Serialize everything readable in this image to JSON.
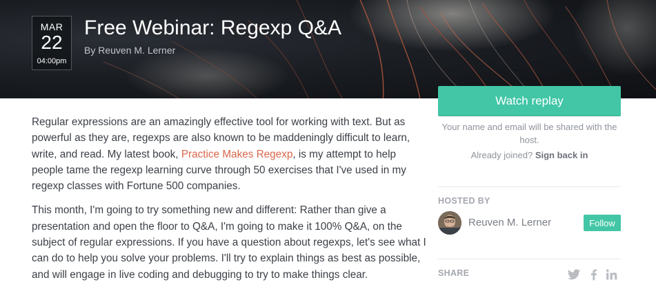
{
  "event": {
    "date": {
      "month": "MAR",
      "day": "22",
      "time": "04:00pm"
    },
    "title": "Free Webinar: Regexp Q&A",
    "byline": "By Reuven M. Lerner"
  },
  "description": {
    "p1_before_link": "Regular expressions are an amazingly effective tool for working with text. But as powerful as they are, regexps are also known to be maddeningly difficult to learn, write, and read. My latest book, ",
    "p1_link": "Practice Makes Regexp",
    "p1_after_link": ", is my attempt to help people tame the regexp learning curve through 50 exercises that I've used in my regexp classes with Fortune 500 companies.",
    "p2": "This month, I'm going to try something new and different: Rather than give a presentation and open the floor to Q&A, I'm going to make it 100% Q&A, on the subject of regular expressions.  If you have a question about regexps, let's see what I can do to help you solve your problems.  I'll try to explain things as best as possible, and will engage in live coding and debugging to try to make things clear."
  },
  "sidebar": {
    "watch_label": "Watch replay",
    "share_note": "Your name and email will be shared with the host.",
    "already_joined": "Already joined?",
    "sign_in_label": "Sign back in",
    "hosted_by_label": "HOSTED BY",
    "host_name": "Reuven M. Lerner",
    "follow_label": "Follow",
    "share_label": "SHARE",
    "share_icons": [
      "twitter-icon",
      "facebook-icon",
      "linkedin-icon"
    ]
  },
  "colors": {
    "accent": "#42c6a6",
    "link": "#d9664a",
    "hero_bg": "#16191e",
    "body_text": "#3b3f46",
    "muted_text": "#8e939b"
  }
}
